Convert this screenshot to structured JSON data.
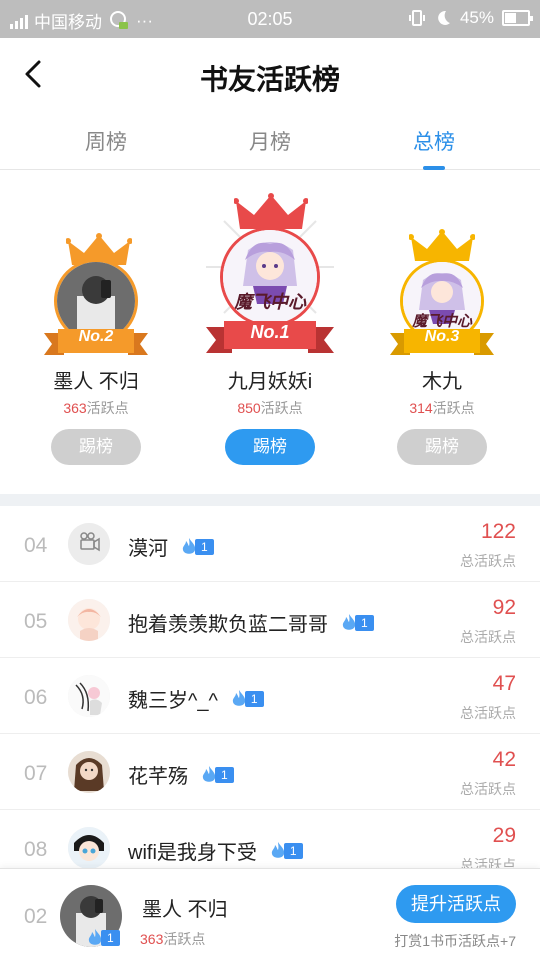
{
  "status_bar": {
    "carrier": "中国移动",
    "network": "4G 4G",
    "more": "···",
    "time": "02:05",
    "battery": "45%"
  },
  "header": {
    "title": "书友活跃榜"
  },
  "tabs": [
    {
      "label": "周榜",
      "active": false
    },
    {
      "label": "月榜",
      "active": false
    },
    {
      "label": "总榜",
      "active": true
    }
  ],
  "podium": {
    "first": {
      "badge": "No.1",
      "name": "九月妖妖i",
      "points": "850",
      "points_label": "活跃点",
      "button": "踢榜"
    },
    "second": {
      "badge": "No.2",
      "name": "墨人 不归",
      "points": "363",
      "points_label": "活跃点",
      "button": "踢榜"
    },
    "third": {
      "badge": "No.3",
      "name": "木九",
      "points": "314",
      "points_label": "活跃点",
      "button": "踢榜"
    },
    "avatar_logo_text": "魔飞中心"
  },
  "list": {
    "value_caption": "总活跃点",
    "rows": [
      {
        "rank": "04",
        "name": "漠河",
        "level": "1",
        "value": "122"
      },
      {
        "rank": "05",
        "name": "抱着羡羡欺负蓝二哥哥",
        "level": "1",
        "value": "92"
      },
      {
        "rank": "06",
        "name": "魏三岁^_^",
        "level": "1",
        "value": "47"
      },
      {
        "rank": "07",
        "name": "花芊殇",
        "level": "1",
        "value": "42"
      },
      {
        "rank": "08",
        "name": "wifi是我身下受",
        "level": "1",
        "value": "29"
      }
    ]
  },
  "my_rank": {
    "rank": "02",
    "name": "墨人 不归",
    "level": "1",
    "points": "363",
    "points_label": "活跃点",
    "boost_button": "提升活跃点",
    "tip": "打赏1书币活跃点+7"
  },
  "colors": {
    "accent": "#2e9af0",
    "points_red": "#e05050",
    "gold": "#f5a623",
    "crown_red": "#e84a4a",
    "crown_orange": "#f59a2a",
    "crown_yellow": "#f7b500"
  },
  "icons": {
    "back": "chevron-left-icon",
    "level": "flame-icon"
  }
}
